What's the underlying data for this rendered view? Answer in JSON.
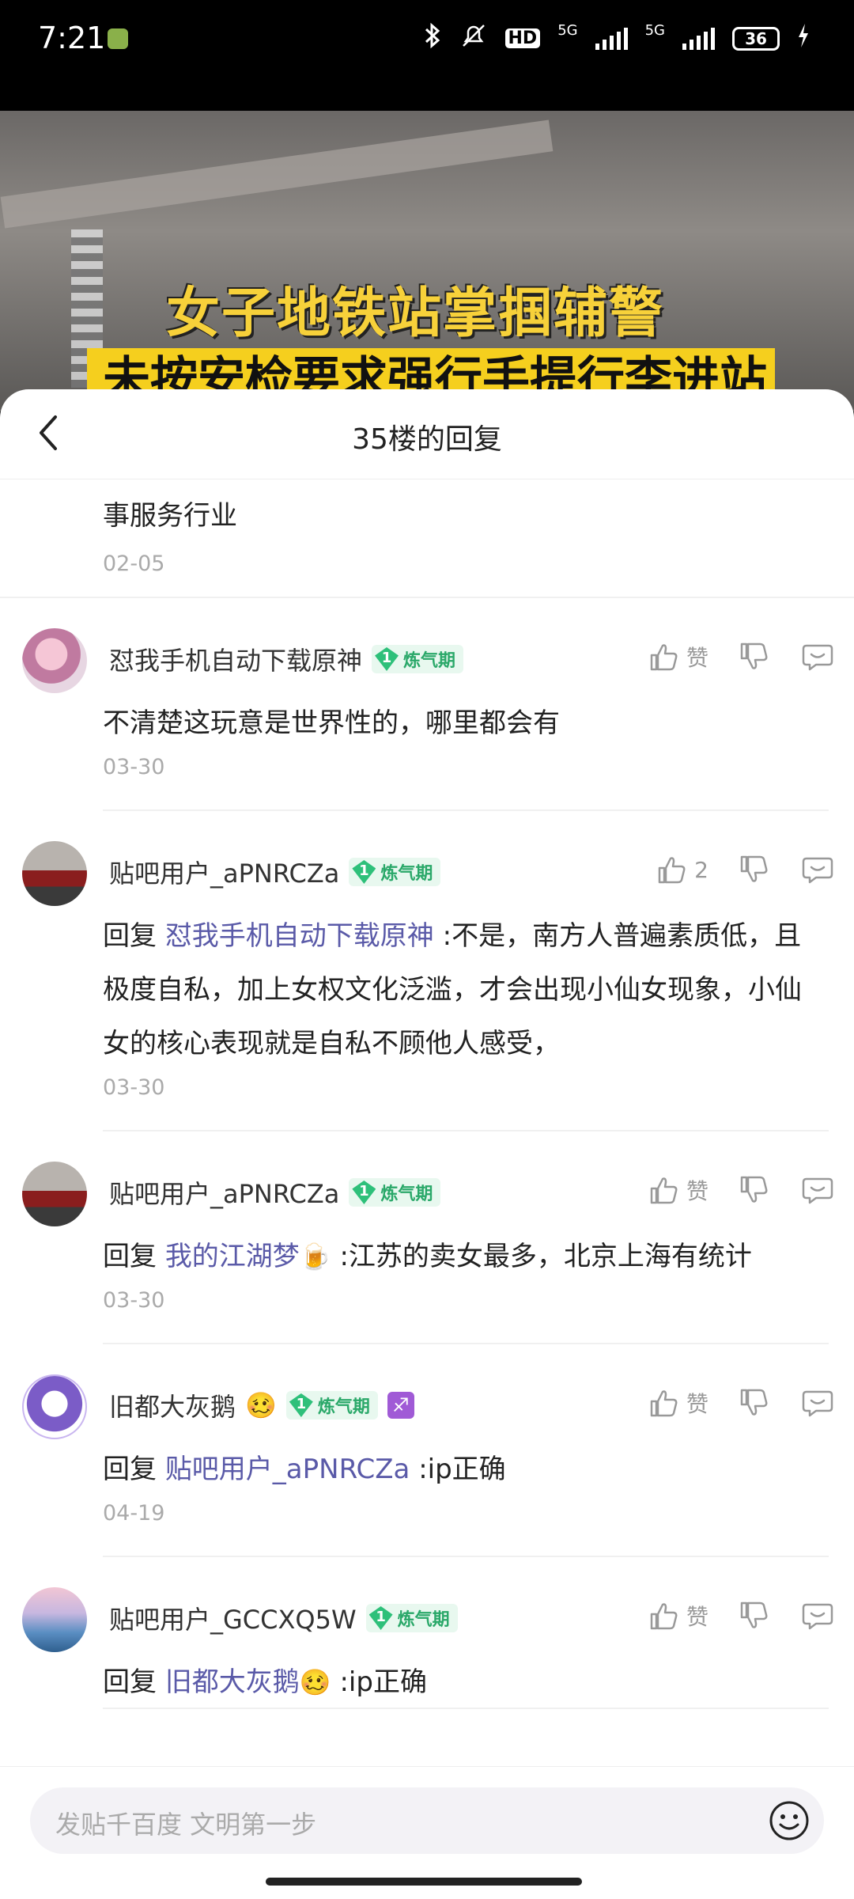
{
  "status_bar": {
    "time": "7:21",
    "hd_label": "HD",
    "net1": "5G",
    "net2": "5G",
    "battery": "36"
  },
  "video": {
    "caption1": "女子地铁站掌掴辅警",
    "caption2": "未按安检要求强行手提行李进站"
  },
  "sheet": {
    "title": "35楼的回复"
  },
  "partial": {
    "text": "事服务行业",
    "date": "02-05"
  },
  "comments": [
    {
      "username": "怼我手机自动下载原神",
      "level": "1",
      "level_label": "炼气期",
      "like_label": "赞",
      "prefix": "",
      "mention": "",
      "mention_emoji": "",
      "text": "不清楚这玩意是世界性的，哪里都会有",
      "date": "03-30"
    },
    {
      "username": "贴吧用户_aPNRCZa",
      "level": "1",
      "level_label": "炼气期",
      "like_label": "2",
      "prefix": "回复 ",
      "mention": "怼我手机自动下载原神",
      "mention_emoji": "",
      "text": " :不是，南方人普遍素质低，且极度自私，加上女权文化泛滥，才会出现小仙女现象，小仙女的核心表现就是自私不顾他人感受，",
      "date": "03-30"
    },
    {
      "username": "贴吧用户_aPNRCZa",
      "level": "1",
      "level_label": "炼气期",
      "like_label": "赞",
      "prefix": "回复 ",
      "mention": "我的江湖梦",
      "mention_emoji": "🍺",
      "text": " :江苏的卖女最多，北京上海有统计",
      "date": "03-30"
    },
    {
      "username": "旧都大灰鹅",
      "username_emoji": "🥴",
      "level": "1",
      "level_label": "炼气期",
      "zodiac": "♐",
      "like_label": "赞",
      "prefix": "回复 ",
      "mention": "贴吧用户_aPNRCZa",
      "mention_emoji": "",
      "text": " :ip正确",
      "date": "04-19"
    },
    {
      "username": "贴吧用户_GCCXQ5W",
      "level": "1",
      "level_label": "炼气期",
      "like_label": "赞",
      "prefix": "回复 ",
      "mention": "旧都大灰鹅",
      "mention_emoji": "🥴",
      "text": " :ip正确",
      "date": ""
    }
  ],
  "input": {
    "placeholder": "发贴千百度 文明第一步"
  }
}
